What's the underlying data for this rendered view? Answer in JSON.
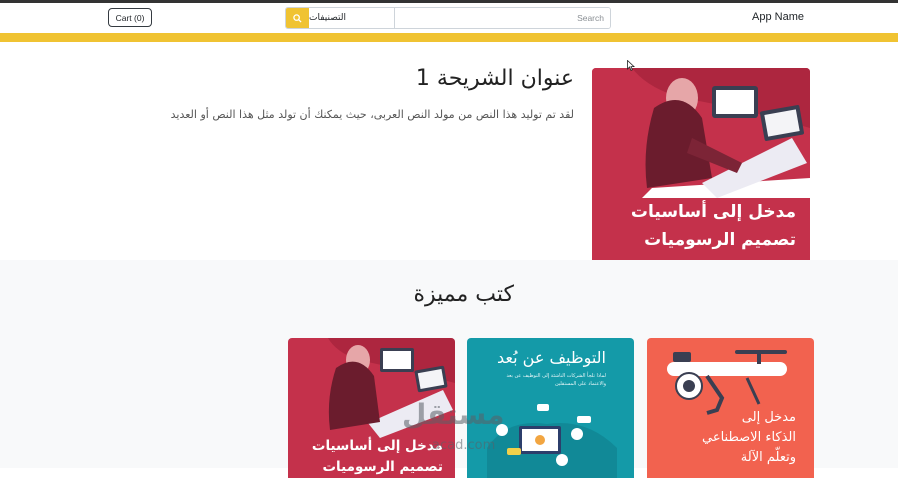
{
  "navbar": {
    "brand": "App Name",
    "search_placeholder": "Search",
    "categories_label": "التصنيفات",
    "cart_label": "Cart (0)"
  },
  "slide": {
    "title": "عنوان الشريحة 1",
    "text": "لقد تم توليد هذا النص من مولد النص العربى، حيث يمكنك أن تولد مثل هذا النص أو العديد",
    "image_title_line1": "مدخل إلى أساسيات",
    "image_title_line2": "تصميم الرسوميات"
  },
  "featured": {
    "title": "كتب مميزة",
    "books": [
      {
        "line1": "مدخل إلى أساسيات",
        "line2": "تصميم الرسوميات"
      },
      {
        "line1": "التوظيف عن بُعد",
        "subtitle": "لماذا تلجأ الشركات الناشئة إلى التوظيف عن بعد والاعتماد على المستقلين"
      },
      {
        "line1": "مدخل إلى",
        "line2": "الذكاء الاصطناعي",
        "line3": "وتعلّم الآلة"
      }
    ]
  },
  "watermark": {
    "text": "مستقل",
    "domain": "acad.com"
  },
  "colors": {
    "accent": "#f0c332",
    "book1": "#c4314b",
    "book2": "#149aa8",
    "book3": "#f2624f"
  },
  "icons": {
    "search": "search-icon",
    "cursor": "mouse-pointer-icon"
  }
}
